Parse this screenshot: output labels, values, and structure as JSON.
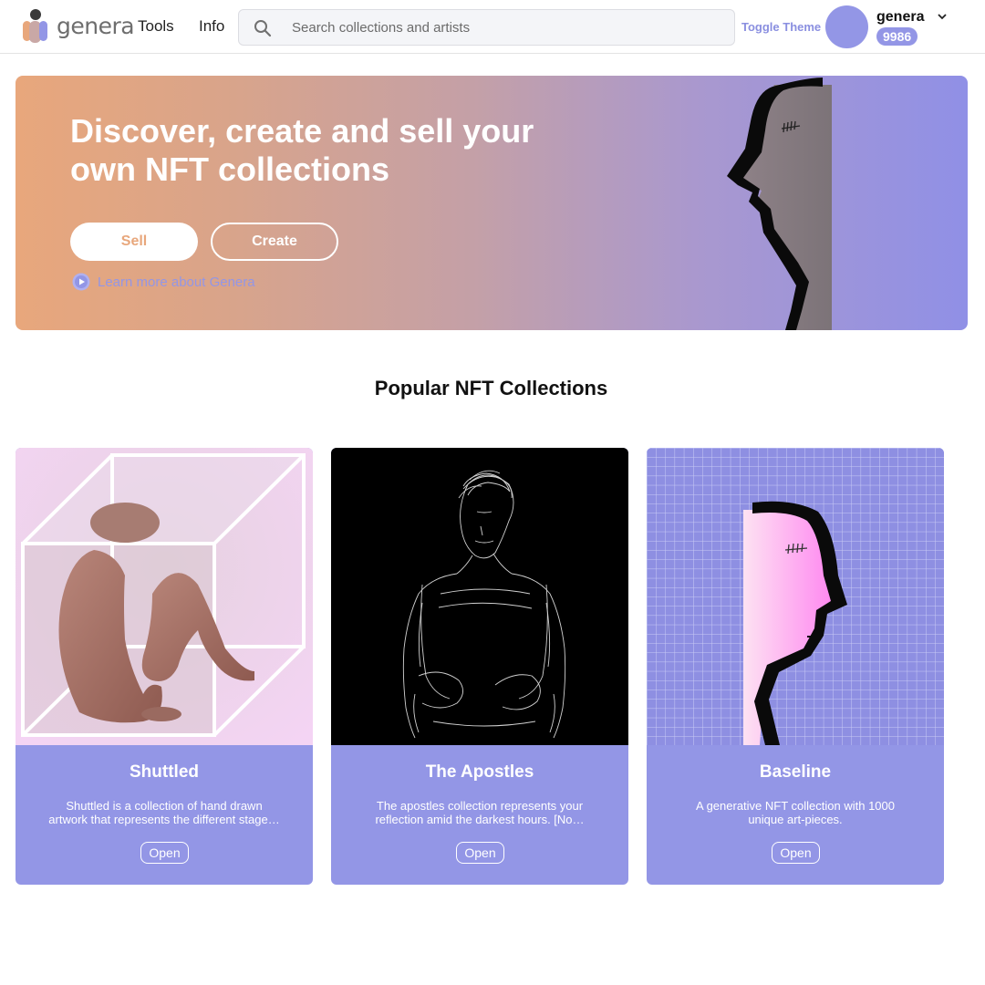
{
  "header": {
    "logo_text": "genera",
    "nav": {
      "tools": "Tools",
      "info": "Info"
    },
    "search": {
      "placeholder": "Search collections and artists",
      "value": ""
    },
    "toggle_theme": "Toggle Theme",
    "user": {
      "name": "genera",
      "balance": "9986"
    }
  },
  "hero": {
    "title": "Discover, create and sell your own NFT collections",
    "sell_label": "Sell",
    "create_label": "Create",
    "learn_more": "Learn more about Genera"
  },
  "section": {
    "title": "Popular NFT Collections"
  },
  "collections": [
    {
      "title": "Shuttled",
      "description": "Shuttled is a collection of hand drawn artwork that represents the different stage…",
      "open_label": "Open"
    },
    {
      "title": "The Apostles",
      "description": "The apostles collection represents your reflection amid the darkest hours. [No…",
      "open_label": "Open"
    },
    {
      "title": "Baseline",
      "description": "A generative NFT collection with 1000 unique art-pieces.",
      "open_label": "Open"
    }
  ],
  "colors": {
    "accent": "#9396e6",
    "hero_start": "#e8a77c",
    "hero_end": "#9090e6"
  }
}
